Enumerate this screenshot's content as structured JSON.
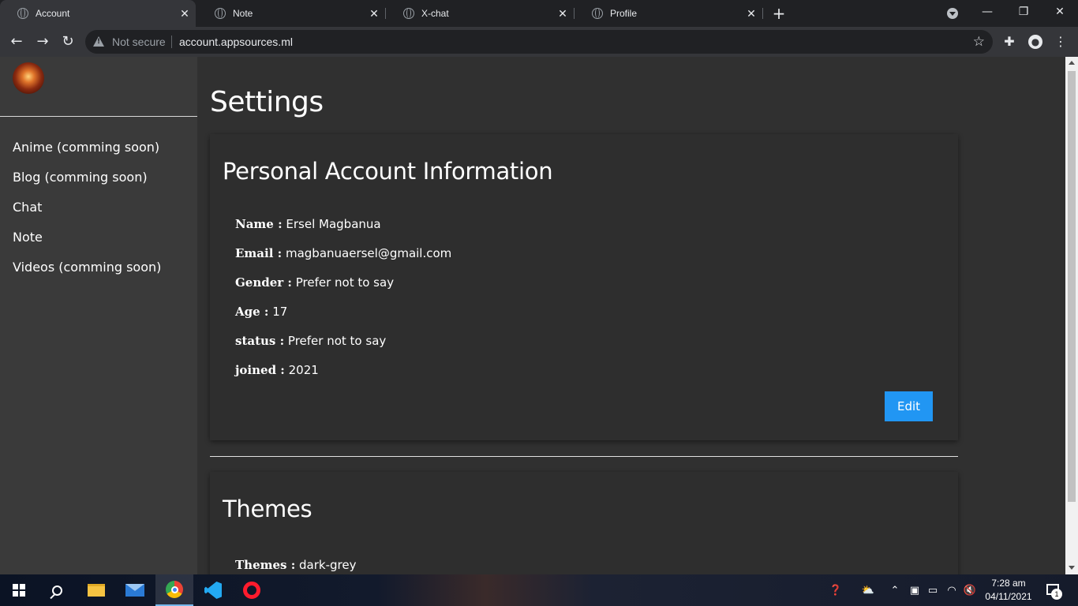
{
  "browser": {
    "tabs": [
      {
        "label": "Account",
        "active": true
      },
      {
        "label": "Note",
        "active": false
      },
      {
        "label": "X-chat",
        "active": false
      },
      {
        "label": "Profile",
        "active": false
      }
    ],
    "new_tab_icon": "+",
    "security_label": "Not secure",
    "url": "account.appsources.ml"
  },
  "sidebar": {
    "items": [
      {
        "label": "Anime (comming soon)"
      },
      {
        "label": "Blog (comming soon)"
      },
      {
        "label": "Chat"
      },
      {
        "label": "Note"
      },
      {
        "label": "Videos (comming soon)"
      }
    ]
  },
  "main": {
    "title": "Settings",
    "personal": {
      "title": "Personal Account Information",
      "fields": [
        {
          "label": "Name :",
          "value": "Ersel Magbanua"
        },
        {
          "label": "Email :",
          "value": "magbanuaersel@gmail.com"
        },
        {
          "label": "Gender :",
          "value": "Prefer not to say"
        },
        {
          "label": "Age :",
          "value": "17"
        },
        {
          "label": "status :",
          "value": "Prefer not to say"
        },
        {
          "label": "joined :",
          "value": "2021"
        }
      ],
      "edit_label": "Edit"
    },
    "themes": {
      "title": "Themes",
      "label": "Themes :",
      "value": "dark-grey"
    }
  },
  "taskbar": {
    "time": "7:28 am",
    "date": "04/11/2021",
    "notification_count": "1"
  },
  "colors": {
    "accent": "#2196f3",
    "page_bg": "#303030",
    "sidebar_bg": "#3a3a3a"
  }
}
